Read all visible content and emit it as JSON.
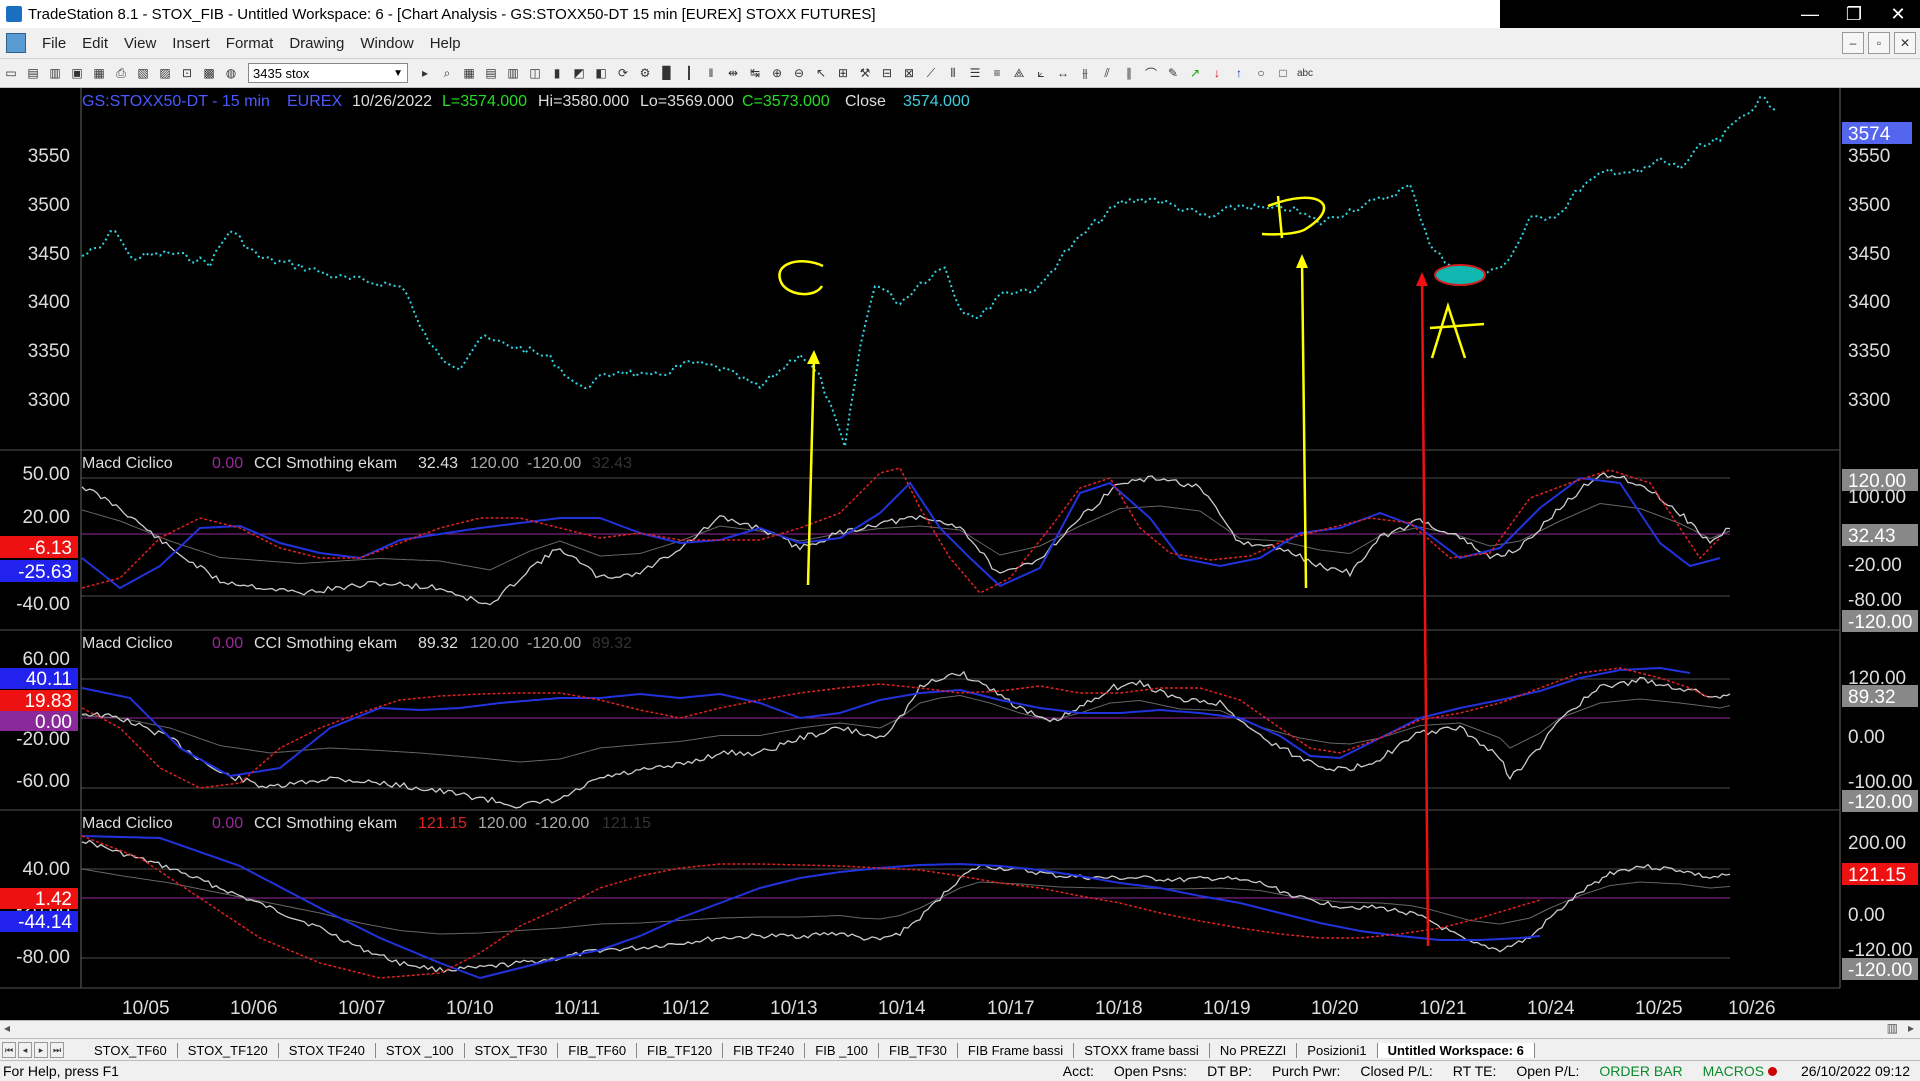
{
  "window": {
    "title": "TradeStation 8.1 - STOX_FIB - Untitled Workspace:  6 - [Chart Analysis - GS:STOXX50-DT  15 min  [EUREX] STOXX FUTURES]",
    "minimize": "—",
    "maximize": "❐",
    "close": "✕"
  },
  "menu": [
    "File",
    "Edit",
    "View",
    "Insert",
    "Format",
    "Drawing",
    "Window",
    "Help"
  ],
  "toolbar": {
    "symbol": "3435 stox"
  },
  "chart": {
    "header": {
      "symbol": "GS:STOXX50-DT - 15 min",
      "exchange": "EUREX",
      "date": "10/26/2022",
      "last": "L=3574.000",
      "hi": "Hi=3580.000",
      "lo": "Lo=3569.000",
      "c": "C=3573.000",
      "close_label": "Close",
      "close_value": "3574.000"
    },
    "price_ticks": [
      "3550",
      "3500",
      "3450",
      "3400",
      "3350",
      "3300"
    ],
    "price_tag": "3574",
    "x_labels": [
      "10/05",
      "10/06",
      "10/07",
      "10/10",
      "10/11",
      "10/12",
      "10/13",
      "10/14",
      "10/17",
      "10/18",
      "10/19",
      "10/20",
      "10/21",
      "10/24",
      "10/25",
      "10/26"
    ],
    "annotations": {
      "c": "C",
      "d": "D",
      "a": "A"
    },
    "panes": [
      {
        "name": "Macd Ciclico",
        "v1": "0.00",
        "name2": "CCI Smothing ekam",
        "v2": "32.43",
        "v3": "120.00",
        "v4": "-120.00",
        "v5": "32.43",
        "left_ticks": [
          "50.00",
          "20.00",
          "-40.00"
        ],
        "left_tags": [
          "-6.13",
          "-25.63"
        ],
        "right_ticks": [
          "100.00",
          "-20.00",
          "-80.00"
        ],
        "right_tags": [
          "120.00",
          "32.43",
          "-120.00"
        ]
      },
      {
        "name": "Macd Ciclico",
        "v1": "0.00",
        "name2": "CCI Smothing ekam",
        "v2": "89.32",
        "v3": "120.00",
        "v4": "-120.00",
        "v5": "89.32",
        "left_ticks": [
          "60.00",
          "-20.00",
          "-60.00"
        ],
        "left_tags": [
          "40.11",
          "19.83",
          "0.00"
        ],
        "right_ticks": [
          "120.00",
          "0.00",
          "-100.00"
        ],
        "right_tags": [
          "89.32",
          "-120.00"
        ]
      },
      {
        "name": "Macd Ciclico",
        "v1": "0.00",
        "name2": "CCI Smothing ekam",
        "v2": "121.15",
        "v3": "120.00",
        "v4": "-120.00",
        "v5": "121.15",
        "left_ticks": [
          "40.00",
          "-20.00",
          "-80.00"
        ],
        "left_tags": [
          "1.42",
          "-44.14"
        ],
        "right_ticks": [
          "200.00",
          "0.00",
          "-120.00"
        ],
        "right_tags": [
          "121.15",
          "-120.00"
        ]
      }
    ]
  },
  "tabs": [
    "STOX_TF60",
    "STOX_TF120",
    "STOX TF240",
    "STOX _100",
    "STOX_TF30",
    "FIB_TF60",
    "FIB_TF120",
    "FIB TF240",
    "FIB _100",
    "FIB_TF30",
    "FIB Frame bassi",
    "STOXX frame bassi",
    "No PREZZI",
    "Posizioni1",
    "Untitled Workspace: 6"
  ],
  "status": {
    "help": "For Help, press F1",
    "acct": "Acct:",
    "open_psns": "Open Psns:",
    "dt_bp": "DT BP:",
    "purch": "Purch Pwr:",
    "closed": "Closed P/L:",
    "rt": "RT TE:",
    "open_pl": "Open P/L:",
    "orderbar": "ORDER BAR",
    "macros": "MACROS",
    "datetime": "26/10/2022 09:12"
  }
}
